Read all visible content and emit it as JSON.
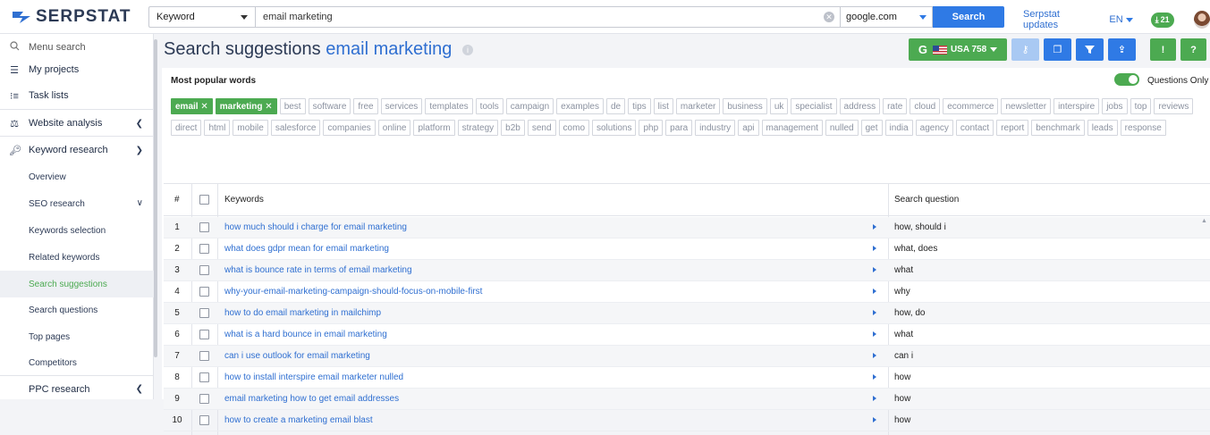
{
  "header": {
    "logo_text": "SERPSTAT",
    "search_type": "Keyword",
    "query": "email marketing",
    "database": "google.com",
    "search_label": "Search",
    "updates_label": "Serpstat updates",
    "lang": "EN",
    "downloads_count": "21"
  },
  "sidebar": {
    "menu_search": "Menu search",
    "my_projects": "My projects",
    "task_lists": "Task lists",
    "website_analysis": "Website analysis",
    "keyword_research": "Keyword research",
    "overview": "Overview",
    "seo_research": "SEO research",
    "keywords_selection": "Keywords selection",
    "related_keywords": "Related keywords",
    "search_suggestions": "Search suggestions",
    "search_questions": "Search questions",
    "top_pages": "Top pages",
    "competitors": "Competitors",
    "ppc_research": "PPC research"
  },
  "main": {
    "title_prefix": "Search suggestions",
    "title_keyword": "email marketing",
    "region_label": "USA 758",
    "popular_words_label": "Most popular words",
    "questions_only_label": "Questions Only",
    "questions_only_on": true,
    "selected_tags": [
      "email ✕",
      "marketing ✕"
    ],
    "tags_row1": [
      "best",
      "software",
      "free",
      "services",
      "templates",
      "tools",
      "campaign",
      "examples",
      "de",
      "tips",
      "list",
      "marketer",
      "business",
      "uk",
      "specialist",
      "address",
      "rate",
      "cloud",
      "ecommerce",
      "newsletter",
      "interspire",
      "jobs",
      "top",
      "reviews"
    ],
    "tags_row2": [
      "direct",
      "html",
      "mobile",
      "salesforce",
      "companies",
      "online",
      "platform",
      "strategy",
      "b2b",
      "send",
      "como",
      "solutions",
      "php",
      "para",
      "industry",
      "api",
      "management",
      "nulled",
      "get",
      "india",
      "agency",
      "contact",
      "report",
      "benchmark",
      "leads",
      "response"
    ]
  },
  "table": {
    "col_num": "#",
    "col_keywords": "Keywords",
    "col_question": "Search question",
    "rows": [
      {
        "n": "1",
        "kw": "how much should i charge for email marketing",
        "q": "how, should i"
      },
      {
        "n": "2",
        "kw": "what does gdpr mean for email marketing",
        "q": "what, does"
      },
      {
        "n": "3",
        "kw": "what is bounce rate in terms of email marketing",
        "q": "what"
      },
      {
        "n": "4",
        "kw": "why-your-email-marketing-campaign-should-focus-on-mobile-first",
        "q": "why"
      },
      {
        "n": "5",
        "kw": "how to do email marketing in mailchimp",
        "q": "how, do"
      },
      {
        "n": "6",
        "kw": "what is a hard bounce in email marketing",
        "q": "what"
      },
      {
        "n": "7",
        "kw": "can i use outlook for email marketing",
        "q": "can i"
      },
      {
        "n": "8",
        "kw": "how to install interspire email marketer nulled",
        "q": "how"
      },
      {
        "n": "9",
        "kw": "email marketing how to get email addresses",
        "q": "how"
      },
      {
        "n": "10",
        "kw": "how to create a marketing email blast",
        "q": "how"
      }
    ]
  },
  "colors": {
    "accent_green": "#4caa51",
    "accent_blue": "#2f7ae5",
    "link_blue": "#2f6fd1"
  }
}
